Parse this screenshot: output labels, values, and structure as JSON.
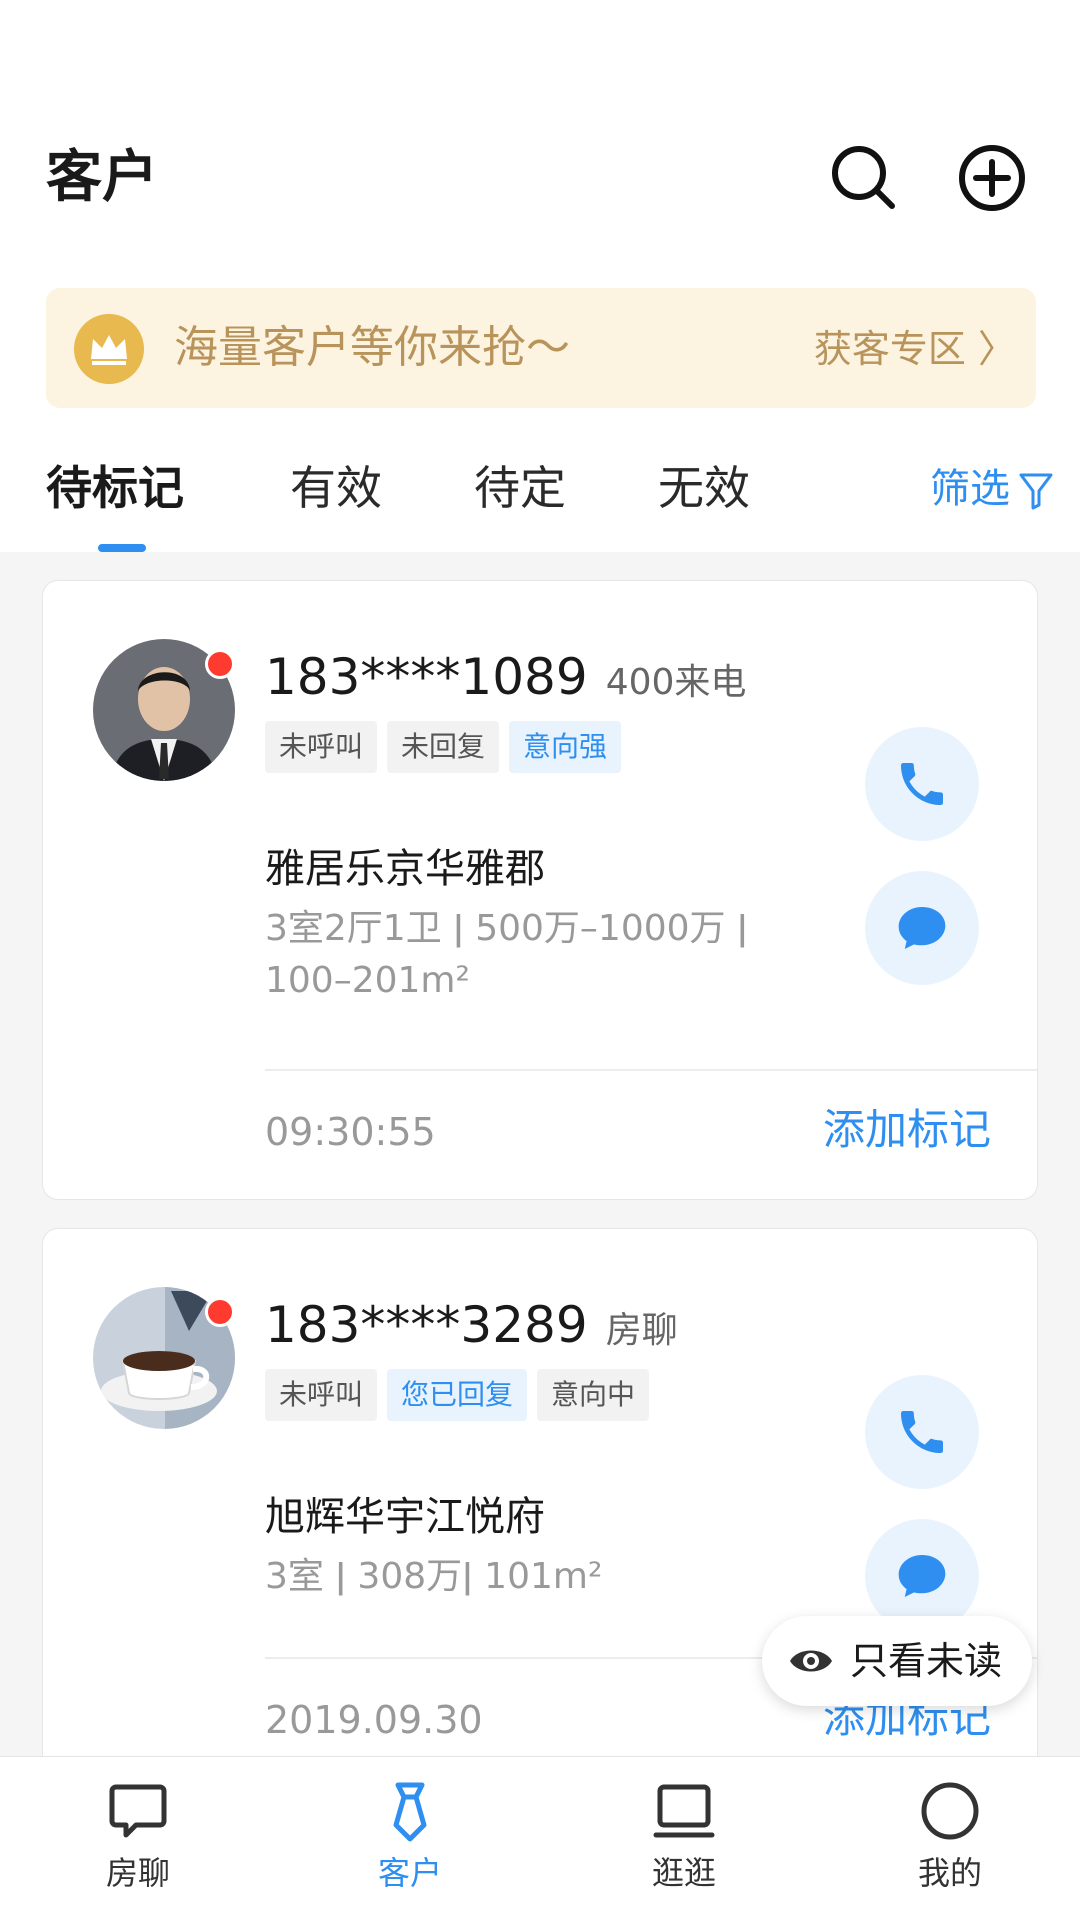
{
  "header": {
    "title": "客户",
    "search_icon": "search-icon",
    "add_icon": "plus-circle-icon"
  },
  "banner": {
    "text": "海量客户等你来抢～",
    "link": "获客专区 〉",
    "icon": "crown-icon"
  },
  "tabs": [
    {
      "label": "待标记",
      "active": true
    },
    {
      "label": "有效"
    },
    {
      "label": "待定"
    },
    {
      "label": "无效"
    }
  ],
  "filter": {
    "label": "筛选",
    "icon": "filter-icon"
  },
  "customers": [
    {
      "phone": "183****1089",
      "source": "400来电",
      "tags": [
        "未呼叫",
        "未回复",
        "意向强"
      ],
      "property": "雅居乐京华雅郡",
      "specs": "3室2厅1卫 ǀ 500万–1000万 ǀ 100–201m²",
      "time": "09:30:55",
      "action": "添加标记",
      "unread": true
    },
    {
      "phone": "183****3289",
      "source": "房聊",
      "tags": [
        "未呼叫",
        "您已回复",
        "意向中"
      ],
      "property": "旭辉华宇江悦府",
      "specs": "3室 ǀ 308万ǀ  101m²",
      "time": "2019.09.30",
      "action": "添加标记",
      "unread": true
    }
  ],
  "unread_toggle": {
    "label": "只看未读",
    "icon": "eye-icon"
  },
  "bottom_nav": [
    {
      "label": "房聊",
      "icon": "chat-bubble-icon"
    },
    {
      "label": "客户",
      "icon": "tie-icon",
      "active": true
    },
    {
      "label": "逛逛",
      "icon": "laptop-icon"
    },
    {
      "label": "我的",
      "icon": "profile-circle-icon"
    }
  ],
  "colors": {
    "accent": "#2e8ff0",
    "banner_bg": "#fcf3e1",
    "banner_text": "#b8935a",
    "unread_dot": "#ff3b30"
  }
}
